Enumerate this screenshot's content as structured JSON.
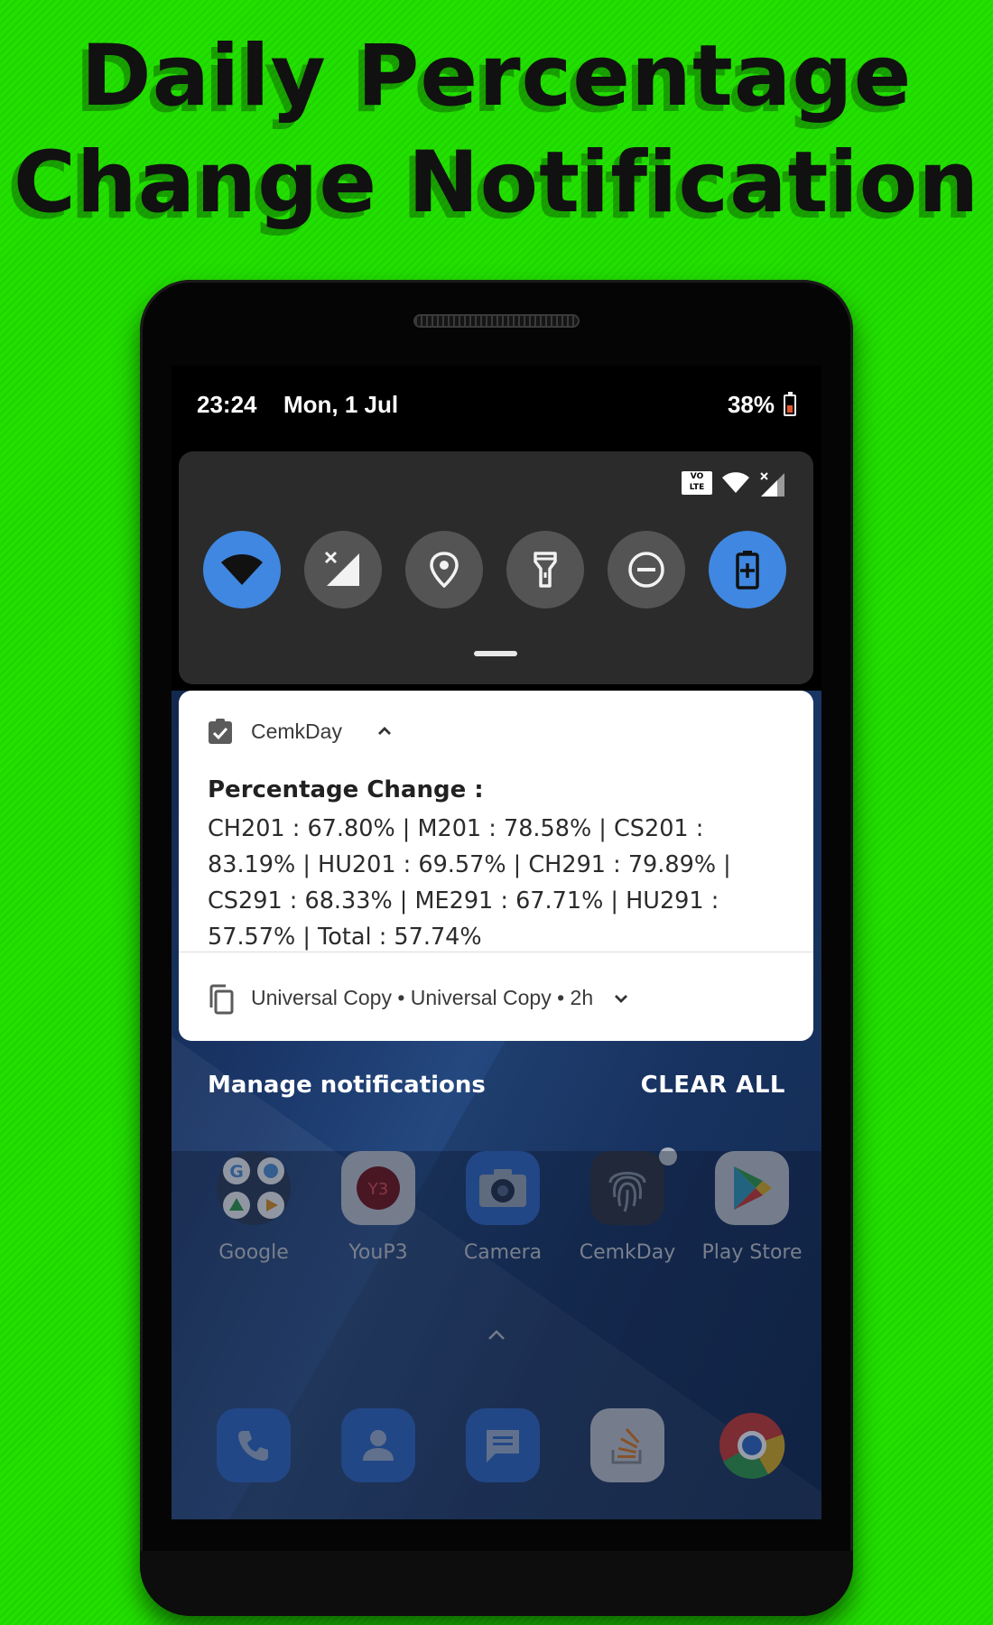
{
  "promo": {
    "line1": "Daily Percentage",
    "line2": "Change Notification"
  },
  "status_bar": {
    "time": "23:24",
    "date": "Mon, 1 Jul",
    "battery": "38%",
    "volte_label": "VO\nLTE"
  },
  "quick_settings": [
    {
      "name": "wifi",
      "icon": "wifi-icon",
      "active": true
    },
    {
      "name": "mobile-data",
      "icon": "cell-signal-off-icon",
      "active": false
    },
    {
      "name": "location",
      "icon": "location-pin-icon",
      "active": false
    },
    {
      "name": "flashlight",
      "icon": "flashlight-icon",
      "active": false
    },
    {
      "name": "do-not-disturb",
      "icon": "dnd-icon",
      "active": false
    },
    {
      "name": "battery-saver",
      "icon": "battery-plus-icon",
      "active": true
    }
  ],
  "notification": {
    "app_name": "CemkDay",
    "title": "Percentage Change :",
    "body": "CH201 : 67.80% | M201 : 78.58% | CS201 : 83.19% | HU201 : 69.57% | CH291 : 79.89% | CS291 : 68.33% | ME291 : 67.71% | HU291 : 57.57% | Total : 57.74%"
  },
  "collapsed_notification": {
    "text": "Universal Copy • Universal Copy • 2h"
  },
  "actions": {
    "manage": "Manage notifications",
    "clear_all": "CLEAR ALL"
  },
  "home_apps": [
    {
      "label": "Google",
      "icon": "google-folder-icon"
    },
    {
      "label": "YouP3",
      "icon": "youp3-icon"
    },
    {
      "label": "Camera",
      "icon": "camera-icon"
    },
    {
      "label": "CemkDay",
      "icon": "fingerprint-icon"
    },
    {
      "label": "Play Store",
      "icon": "play-store-icon"
    }
  ],
  "dock": [
    {
      "icon": "phone-icon"
    },
    {
      "icon": "contacts-icon"
    },
    {
      "icon": "messages-icon"
    },
    {
      "icon": "stack-overflow-icon"
    },
    {
      "icon": "chrome-icon"
    }
  ],
  "colors": {
    "background": "#22e000",
    "accent": "#3f87e0",
    "tile_inactive": "#545454"
  }
}
